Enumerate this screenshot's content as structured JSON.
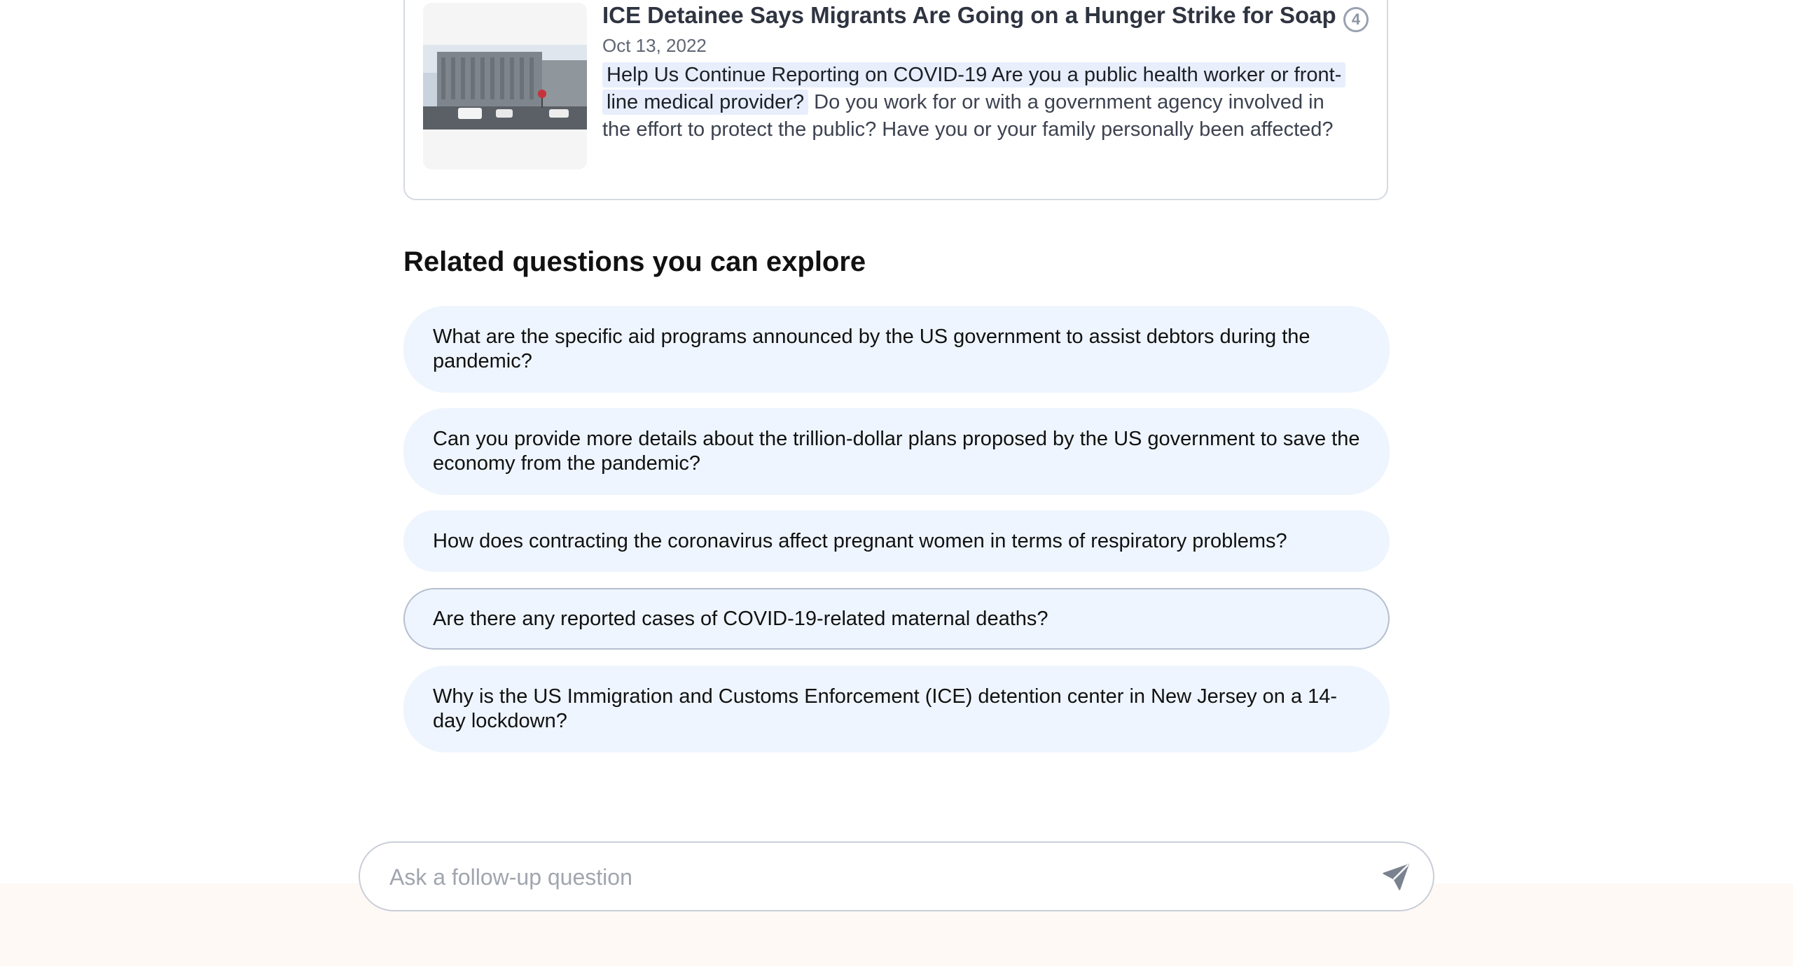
{
  "source_card": {
    "title": "ICE Detainee Says Migrants Are Going on a Hunger Strike for Soap",
    "date": "Oct 13, 2022",
    "excerpt_highlight": "Help Us Continue Reporting on COVID-19 Are you a public health worker or front-line medical provider?",
    "excerpt_rest": " Do you work for or with a government agency involved in the effort to protect the public? Have you or your family personally been affected?",
    "citation_number": "4",
    "thumbnail_icon": "detention-center-photo"
  },
  "related": {
    "heading": "Related questions you can explore",
    "items": [
      {
        "label": "What are the specific aid programs announced by the US government to assist debtors during the pandemic?"
      },
      {
        "label": "Can you provide more details about the trillion-dollar plans proposed by the US government to save the economy from the pandemic?"
      },
      {
        "label": "How does contracting the coronavirus affect pregnant women in terms of respiratory problems?"
      },
      {
        "label": "Are there any reported cases of COVID-19-related maternal deaths?"
      },
      {
        "label": "Why is the US Immigration and Customs Enforcement (ICE) detention center in New Jersey on a 14-day lockdown?"
      }
    ]
  },
  "followup": {
    "placeholder": "Ask a follow-up question",
    "value": "",
    "send_icon": "send-icon"
  },
  "colors": {
    "pill_bg": "#eef5fe",
    "highlight_bg": "#e8eefb",
    "footer_bg": "#fff9f5",
    "card_border": "#d5d9e2"
  }
}
